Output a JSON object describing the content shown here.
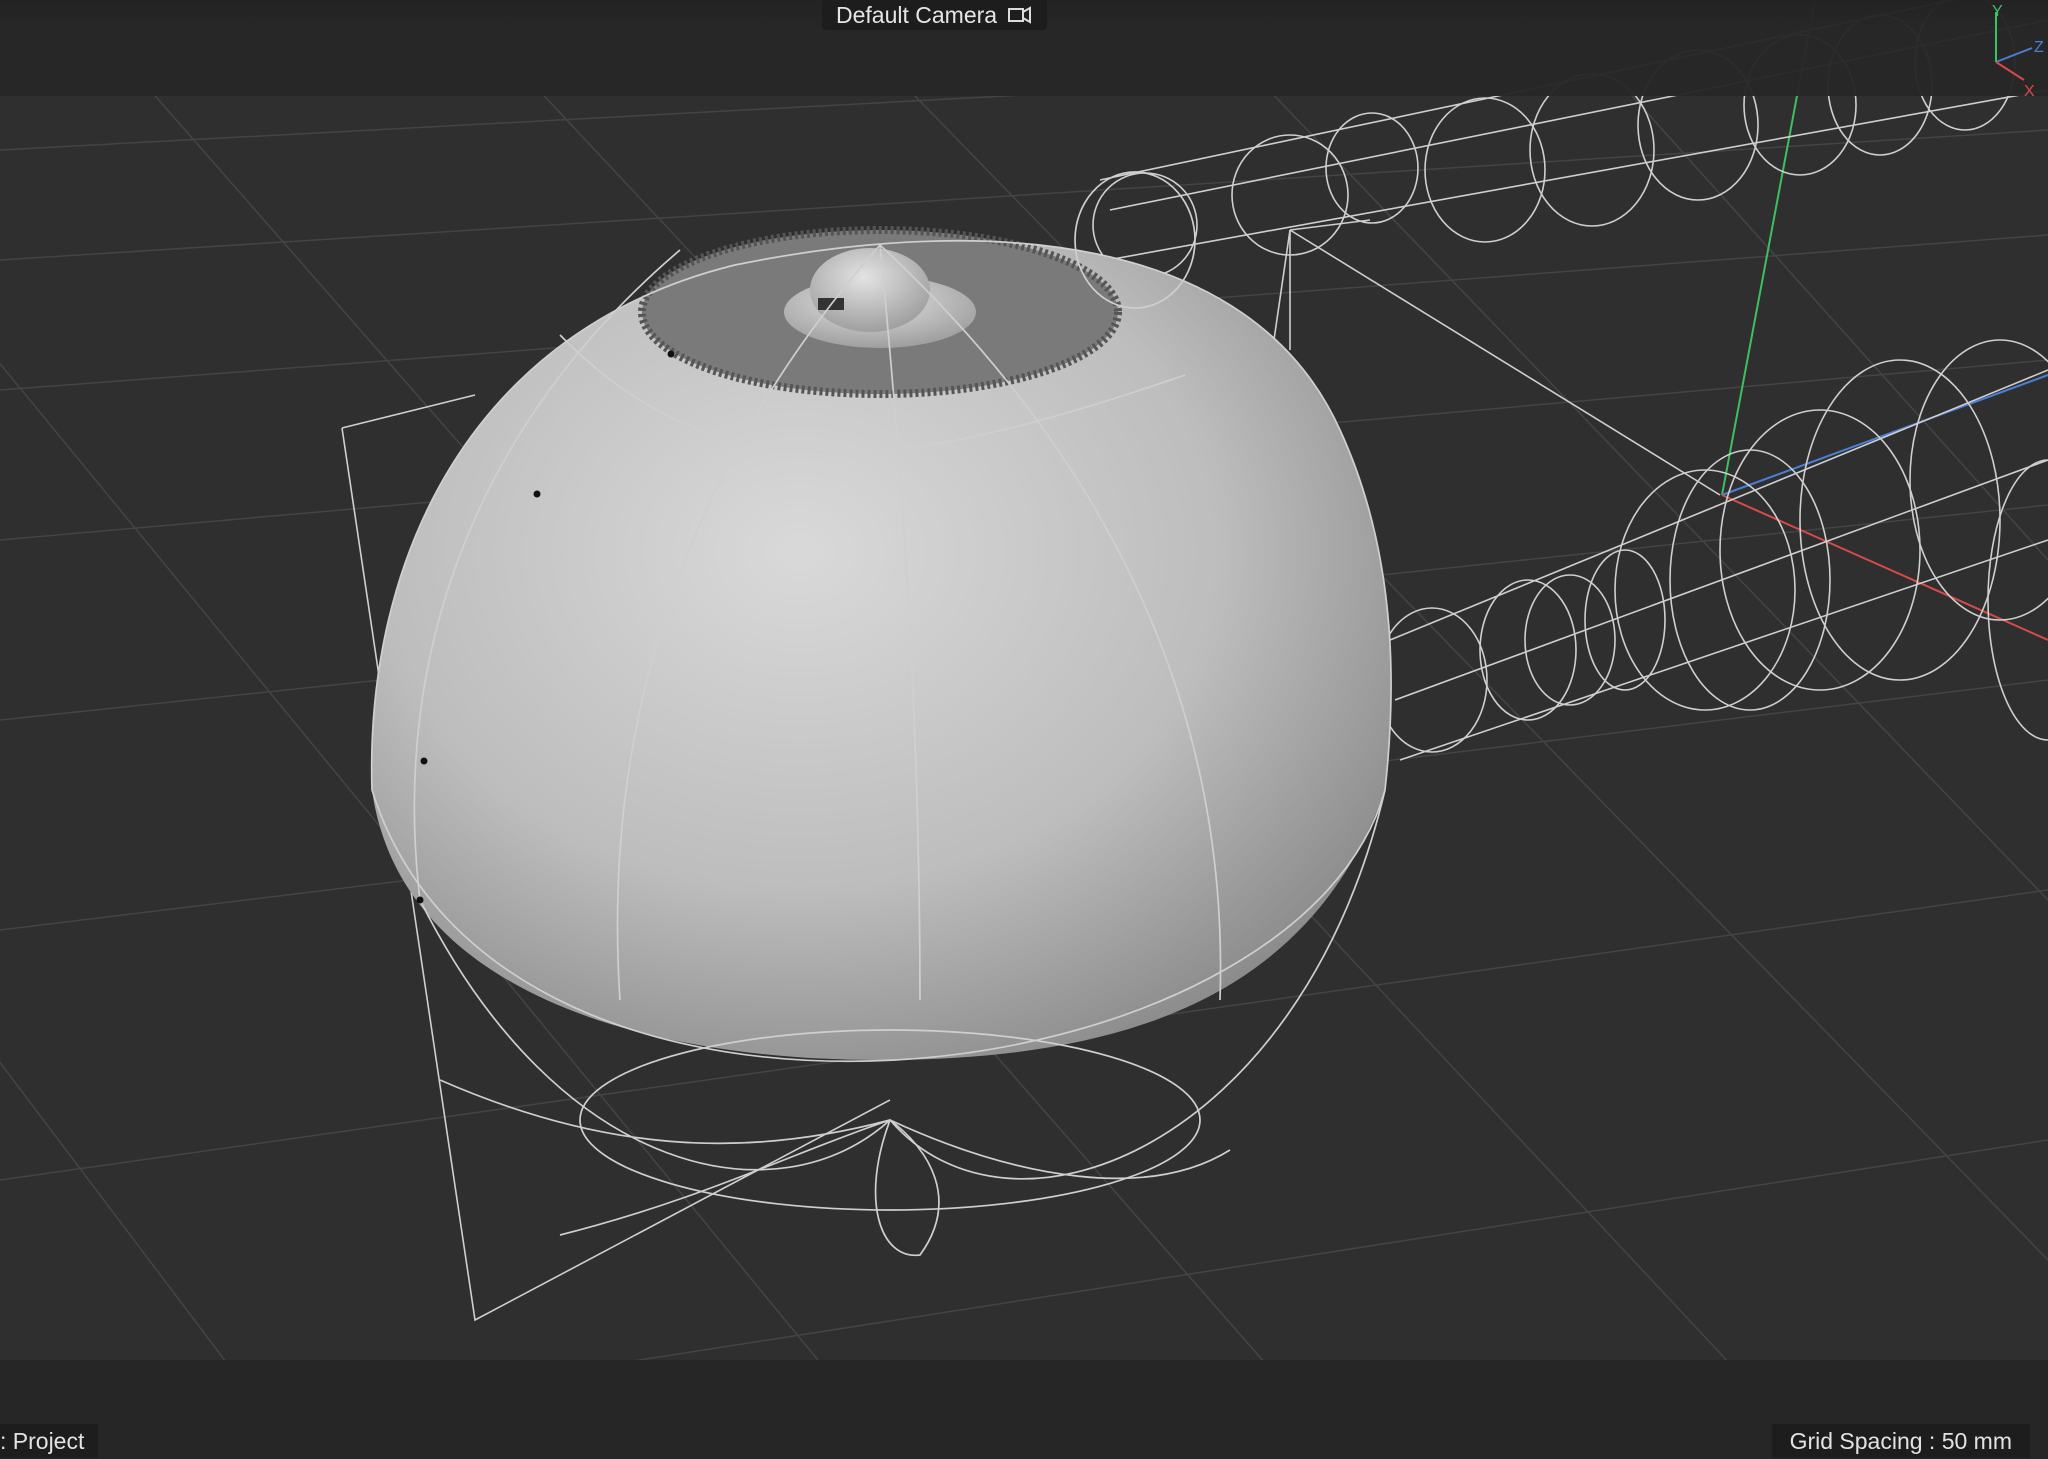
{
  "viewport": {
    "camera_label": "Default Camera",
    "camera_icon": "camera-icon",
    "project_label": ": Project",
    "grid_spacing": "Grid Spacing : 50 mm",
    "axis_labels": {
      "y": "Y",
      "z": "Z",
      "x": "X"
    }
  },
  "colors": {
    "background": "#2f2f2f",
    "grid_line": "#444444",
    "wireframe": "#cfcfcf",
    "axis_x": "#d84a4a",
    "axis_y": "#3fbf5f",
    "axis_z": "#4a7fd8"
  }
}
